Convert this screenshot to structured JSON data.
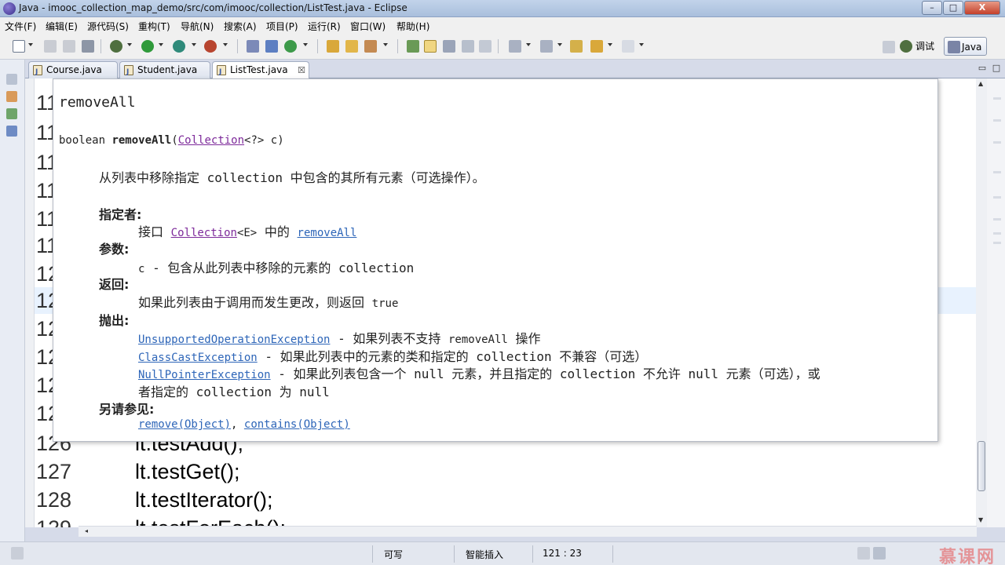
{
  "window": {
    "title": "Java - imooc_collection_map_demo/src/com/imooc/collection/ListTest.java - Eclipse",
    "minimize": "–",
    "maximize": "□",
    "close": "X"
  },
  "menu": {
    "items": [
      "文件(F)",
      "编辑(E)",
      "源代码(S)",
      "重构(T)",
      "导航(N)",
      "搜索(A)",
      "项目(P)",
      "运行(R)",
      "窗口(W)",
      "帮助(H)"
    ]
  },
  "toolbar": {
    "perspective_debug": "调试",
    "perspective_java": "Java"
  },
  "tabs": [
    {
      "label": "Course.java",
      "active": false
    },
    {
      "label": "Student.java",
      "active": false
    },
    {
      "label": "ListTest.java",
      "active": true,
      "close": "☒"
    }
  ],
  "editor": {
    "hidden_line_prefix": "1",
    "visible_lines": [
      {
        "num": "126",
        "code": "lt.testAdd();"
      },
      {
        "num": "127",
        "code": "lt.testGet();"
      },
      {
        "num": "128",
        "code": "lt.testIterator();"
      },
      {
        "num": "129",
        "code": "lt.testForEach();"
      }
    ],
    "partial_nums": [
      "11",
      "11",
      "11",
      "11",
      "11",
      "11",
      "12",
      "12",
      "12",
      "12",
      "12",
      "12"
    ]
  },
  "javadoc": {
    "title": "removeAll",
    "signature": {
      "return_type": "boolean",
      "method": "removeAll",
      "open": "(",
      "param_type": "Collection",
      "param_rest": "<?> c)"
    },
    "description": "从列表中移除指定 collection 中包含的其所有元素（可选操作）。",
    "specified_by": {
      "heading": "指定者:",
      "prefix": "接口",
      "interface": "Collection",
      "type_param": "<E>",
      "middle": "中的",
      "method": "removeAll"
    },
    "params": {
      "heading": "参数:",
      "name": "c",
      "text": "- 包含从此列表中移除的元素的 collection"
    },
    "returns": {
      "heading": "返回:",
      "text": "如果此列表由于调用而发生更改，则返回",
      "value": "true"
    },
    "throws": {
      "heading": "抛出:",
      "items": [
        {
          "exception": "UnsupportedOperationException",
          "text_a": " - 如果列表不支持 ",
          "code": "removeAll",
          "text_b": " 操作"
        },
        {
          "exception": "ClassCastException",
          "text_a": " - 如果此列表中的元素的类和指定的 collection 不兼容（可选）",
          "code": "",
          "text_b": ""
        },
        {
          "exception": "NullPointerException",
          "text_a": " - 如果此列表包含一个 null 元素，并且指定的 collection 不允许 null 元素（可选），或",
          "code": "",
          "text_b": ""
        }
      ],
      "continuation": "者指定的 collection 为 null"
    },
    "see_also": {
      "heading": "另请参见:",
      "link1": "remove(Object)",
      "separator": ",",
      "link2": "contains(Object)"
    }
  },
  "statusbar": {
    "writable": "可写",
    "insert_mode": "智能插入",
    "position": "121 : 23",
    "watermark": "慕课网"
  },
  "colors": {
    "link": "#2d65b8",
    "visited_link": "#7d2a9a",
    "current_line": "#e8f2fe"
  }
}
